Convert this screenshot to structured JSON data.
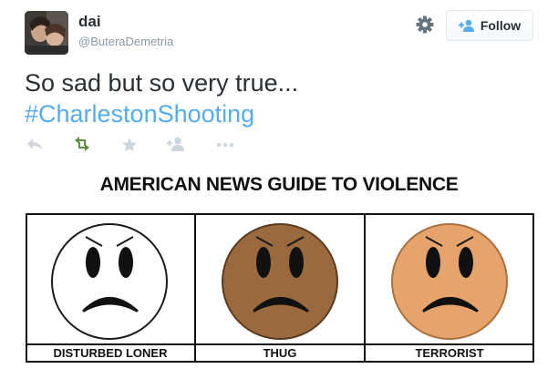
{
  "tweet": {
    "display_name": "dai",
    "handle": "@ButeraDemetria",
    "text": "So sad but so very true...",
    "hashtag": "#CharlestonShooting"
  },
  "header": {
    "follow_label": "Follow",
    "settings_icon": "gear-icon",
    "follow_icon": "add-user-icon"
  },
  "actions": [
    {
      "name": "reply",
      "icon": "reply-icon"
    },
    {
      "name": "retweet",
      "icon": "retweet-icon",
      "color": "#5c913b"
    },
    {
      "name": "favorite",
      "icon": "star-icon"
    },
    {
      "name": "follow",
      "icon": "add-user-icon"
    },
    {
      "name": "more",
      "icon": "more-icon"
    }
  ],
  "cartoon": {
    "title": "AMERICAN NEWS GUIDE TO VIOLENCE",
    "panels": [
      {
        "label": "DISTURBED LONER",
        "face_color": "#ffffff"
      },
      {
        "label": "THUG",
        "face_color": "#9a6a3e"
      },
      {
        "label": "TERRORIST",
        "face_color": "#e6a46c"
      }
    ]
  },
  "colors": {
    "hashtag": "#55acee",
    "secondary_text": "#8899a6",
    "action_gray": "#ccd6dd"
  }
}
